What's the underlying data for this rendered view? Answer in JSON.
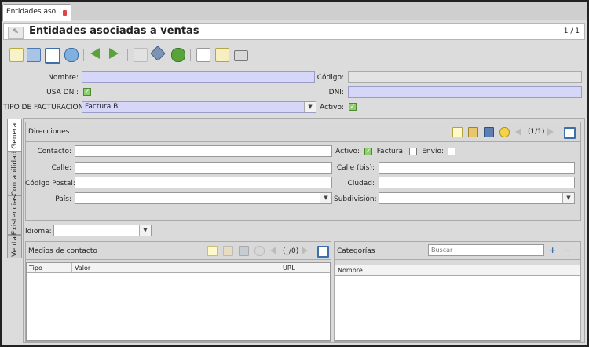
{
  "tab": {
    "label": "Entidades aso ..."
  },
  "header": {
    "title": "Entidades asociadas a ventas",
    "record": "1 / 1"
  },
  "toolbar": {
    "buttons": [
      "new-icon",
      "save-icon",
      "fullscreen-icon",
      "refresh-icon",
      "previous-icon",
      "next-icon",
      "attach-icon",
      "switch-icon",
      "reload-icon",
      "note-icon",
      "edit-note-icon",
      "print-icon"
    ]
  },
  "form": {
    "nombre_label": "Nombre:",
    "codigo_label": "Código:",
    "usa_dni_label": "USA DNI:",
    "dni_label": "DNI:",
    "tipo_facturacion_label": "TIPO DE FACTURACION:",
    "tipo_facturacion_value": "Factura B",
    "activo_label": "Activo:"
  },
  "vtabs": [
    "General",
    "Contabilidad",
    "Existencias",
    "Venta"
  ],
  "direcciones": {
    "title": "Direcciones",
    "pager": "(1/1)",
    "contacto_label": "Contacto:",
    "activo_label": "Activo:",
    "factura_label": "Factura:",
    "envio_label": "Envío:",
    "calle_label": "Calle:",
    "calle_bis_label": "Calle (bis):",
    "codigo_postal_label": "Código Postal:",
    "ciudad_label": "Ciudad:",
    "pais_label": "País:",
    "subdivision_label": "Subdivisión:"
  },
  "idioma": {
    "label": "Idioma:"
  },
  "medios": {
    "title": "Medios de contacto",
    "pager": "(_/0)",
    "columns": [
      "Tipo",
      "Valor",
      "URL"
    ]
  },
  "categorias": {
    "title": "Categorías",
    "search_placeholder": "Buscar",
    "columns": [
      "Nombre"
    ]
  }
}
